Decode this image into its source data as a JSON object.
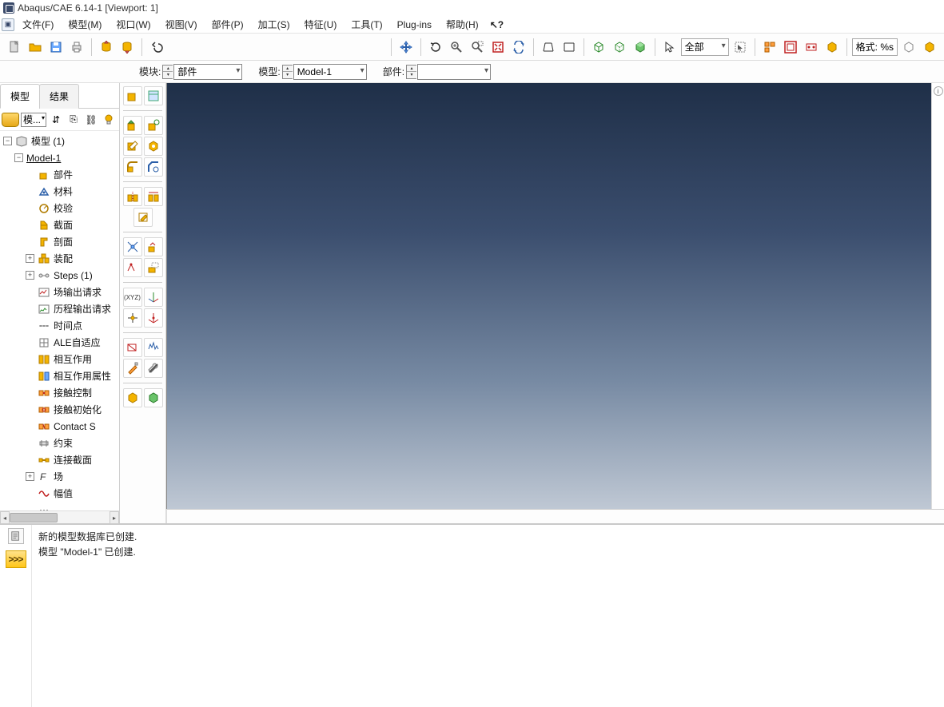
{
  "title": "Abaqus/CAE 6.14-1  [Viewport: 1]",
  "menus": [
    "文件(F)",
    "模型(M)",
    "视口(W)",
    "视图(V)",
    "部件(P)",
    "加工(S)",
    "特征(U)",
    "工具(T)",
    "Plug-ins",
    "帮助(H)"
  ],
  "help_cursor": "↖?",
  "view_combo": "全部",
  "format_label": "格式: %s",
  "context": {
    "module_lbl": "模块:",
    "module_val": "部件",
    "model_lbl": "模型:",
    "model_val": "Model-1",
    "part_lbl": "部件:",
    "part_val": ""
  },
  "left_tabs": {
    "model": "模型",
    "results": "结果"
  },
  "left_combo": "模...",
  "tree": {
    "root": "模型 (1)",
    "model": "Model-1",
    "items": [
      {
        "icon": "part",
        "label": "部件"
      },
      {
        "icon": "material",
        "label": "材料"
      },
      {
        "icon": "calib",
        "label": "校验"
      },
      {
        "icon": "section",
        "label": "截面"
      },
      {
        "icon": "profile",
        "label": "剖面"
      },
      {
        "icon": "assembly",
        "label": "装配",
        "expand": true
      },
      {
        "icon": "steps",
        "label": "Steps (1)",
        "expand": true
      },
      {
        "icon": "fieldout",
        "label": "场输出请求"
      },
      {
        "icon": "histout",
        "label": "历程输出请求"
      },
      {
        "icon": "timepts",
        "label": "时间点"
      },
      {
        "icon": "ale",
        "label": "ALE自适应"
      },
      {
        "icon": "interact",
        "label": "相互作用"
      },
      {
        "icon": "intprop",
        "label": "相互作用属性"
      },
      {
        "icon": "contactc",
        "label": "接触控制"
      },
      {
        "icon": "contacti",
        "label": "接触初始化"
      },
      {
        "icon": "contacts",
        "label": "Contact S"
      },
      {
        "icon": "constr",
        "label": "约束"
      },
      {
        "icon": "connsec",
        "label": "连接截面"
      },
      {
        "icon": "field",
        "label": "场",
        "expand": true
      },
      {
        "icon": "amp",
        "label": "幅值"
      },
      {
        "icon": "more",
        "label": "..."
      }
    ]
  },
  "messages": {
    "line1": "新的模型数据库已创建.",
    "line2": "模型 \"Model-1\" 已创建."
  },
  "kcli_label": ">>>"
}
